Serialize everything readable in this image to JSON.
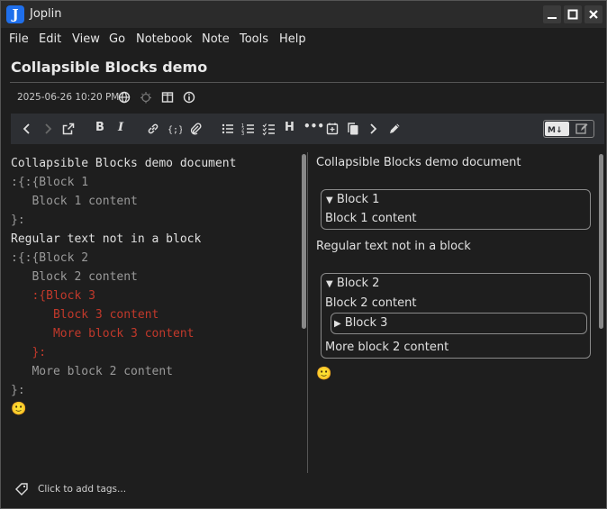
{
  "window": {
    "app_title": "Joplin",
    "logo_letter": "J"
  },
  "menu": [
    "File",
    "Edit",
    "View",
    "Go",
    "Notebook",
    "Note",
    "Tools",
    "Help"
  ],
  "note": {
    "title": "Collapsible Blocks demo",
    "date": "2025-06-26 10:20 PM"
  },
  "toolbar": {
    "bold": "B",
    "italic": "I",
    "heading": "H",
    "more": "•••"
  },
  "editor": {
    "lines": [
      {
        "text": "Collapsible Blocks demo document",
        "color": "#e0e0e0"
      },
      {
        "text": ":{:{Block 1",
        "color": "#9a9a9a"
      },
      {
        "text": "   Block 1 content",
        "color": "#9a9a9a"
      },
      {
        "text": "}:",
        "color": "#9a9a9a"
      },
      {
        "text": "Regular text not in a block",
        "color": "#e0e0e0"
      },
      {
        "text": ":{:{Block 2",
        "color": "#9a9a9a"
      },
      {
        "text": "   Block 2 content",
        "color": "#9a9a9a"
      },
      {
        "text": "   :{Block 3",
        "color": "#c2392b"
      },
      {
        "text": "      Block 3 content",
        "color": "#c2392b"
      },
      {
        "text": "      More block 3 content",
        "color": "#c2392b"
      },
      {
        "text": "   }:",
        "color": "#c2392b"
      },
      {
        "text": "   More block 2 content",
        "color": "#9a9a9a"
      },
      {
        "text": "}:",
        "color": "#9a9a9a"
      }
    ],
    "emoji": "🙂"
  },
  "viewer": {
    "heading": "Collapsible Blocks demo document",
    "block1_summary": "Block 1",
    "block1_content": "Block 1 content",
    "regular": "Regular text not in a block",
    "block2_summary": "Block 2",
    "block2_content": "Block 2 content",
    "block3_summary": "Block 3",
    "block2_more": "More block 2 content",
    "emoji": "🙂"
  },
  "tags": {
    "placeholder": "Click to add tags..."
  },
  "colors": {
    "accent": "#1f6feb",
    "block_red": "#c2392b"
  }
}
